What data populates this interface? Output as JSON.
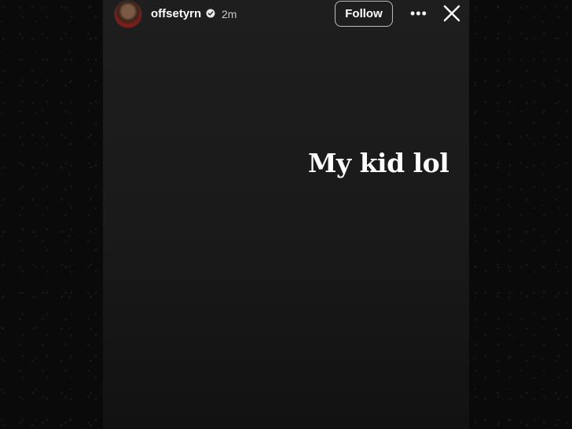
{
  "story": {
    "username": "offsetyrn",
    "time_ago": "2m",
    "follow_label": "Follow",
    "caption": "My kid lol"
  },
  "icons": {
    "verified": "verified-badge-icon",
    "more": "more-options-icon",
    "close": "close-icon"
  },
  "colors": {
    "background": "#0b0b0b",
    "story_background": "#1c1c1c",
    "text": "#ffffff"
  }
}
